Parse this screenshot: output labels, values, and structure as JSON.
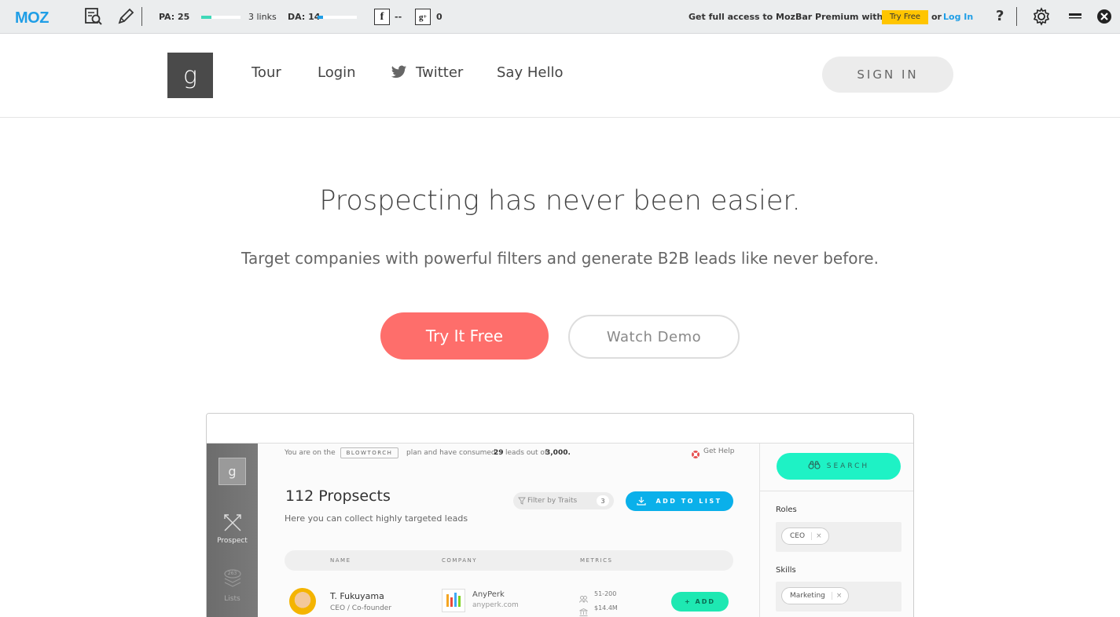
{
  "mozbar": {
    "logo": "MOZ",
    "pa_label": "PA: 25",
    "pa_fill": 0.25,
    "links": "3 links",
    "da_label": "DA: 14",
    "da_fill": 0.14,
    "fb_count": "--",
    "gplus_count": "0",
    "promo_text": "Get full access to MozBar Premium with Moz Pro",
    "try_free": "Try Free",
    "or": "or",
    "login": "Log In",
    "help": "?",
    "colors": {
      "accent": "#1f9ee6",
      "pa_bar": "#3fd8b8",
      "da_bar": "#1f9ee6",
      "try_free_bg": "#ffc500"
    }
  },
  "header": {
    "logo_glyph": "g",
    "nav": [
      "Tour",
      "Login",
      "Twitter",
      "Say Hello"
    ],
    "signin": "SIGN IN"
  },
  "hero": {
    "title": "Prospecting has never been easier.",
    "subtitle": "Target companies with powerful filters and generate B2B leads like never before.",
    "try_button": "Try It Free",
    "demo_button": "Watch Demo",
    "colors": {
      "try_bg": "#fe6e6b"
    }
  },
  "preview": {
    "sidebar": {
      "logo_glyph": "g",
      "prospect": "Prospect",
      "lists": "Lists",
      "lists_count": "263"
    },
    "plan_prefix": "You are on the",
    "plan_name": "BLOWTORCH",
    "plan_mid": "plan and have consumed",
    "plan_used": "29",
    "plan_mid2": "leads out of",
    "plan_total": "3,000.",
    "get_help": "Get Help",
    "title": "112 Propsects",
    "subtitle": "Here you can collect highly targeted leads",
    "filter": "Filter by Traits",
    "filter_count": "3",
    "add_to_list": "ADD TO LIST",
    "columns": [
      "NAME",
      "COMPANY",
      "METRICS"
    ],
    "row": {
      "name": "T. Fukuyama",
      "title": "CEO / Co-founder",
      "company": "AnyPerk",
      "domain": "anyperk.com",
      "employees": "51-200",
      "revenue": "$14.4M",
      "add": "+ ADD"
    },
    "right": {
      "search": "SEARCH",
      "roles_label": "Roles",
      "roles_tag": "CEO",
      "skills_label": "Skills",
      "skills_tag": "Marketing",
      "remove": "×"
    }
  }
}
